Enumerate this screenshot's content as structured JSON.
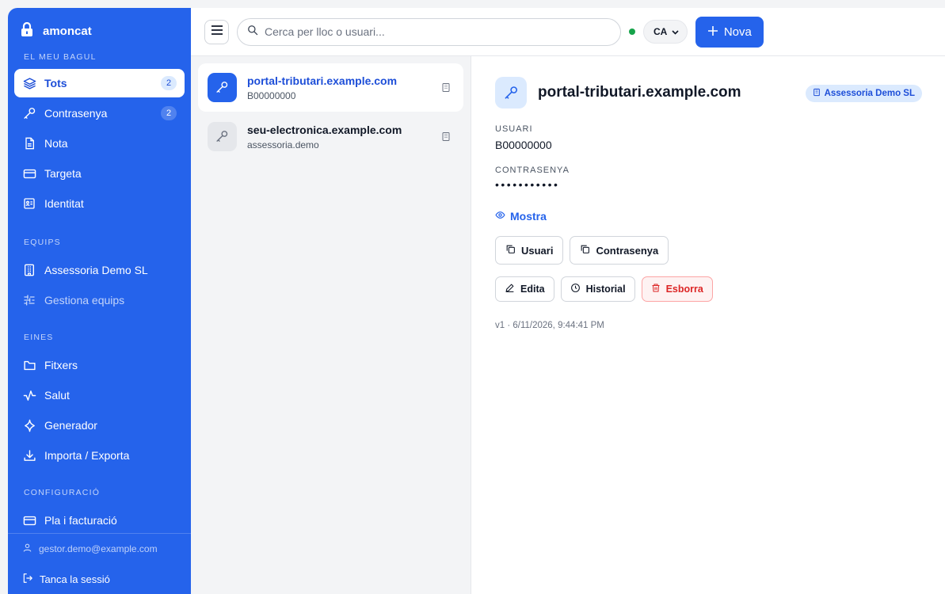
{
  "brand": {
    "name": "amoncat",
    "icon": "lock-icon"
  },
  "sidebar": {
    "sections": {
      "vault": "EL MEU BAGUL",
      "teams": "EQUIPS",
      "tools": "EINES",
      "settings": "CONFIGURACIÓ"
    },
    "vault_items": [
      {
        "label": "Tots",
        "count": "2",
        "icon": "layers-icon",
        "active": true
      },
      {
        "label": "Contrasenya",
        "count": "2",
        "icon": "key-icon"
      },
      {
        "label": "Nota",
        "icon": "note-icon"
      },
      {
        "label": "Targeta",
        "icon": "card-icon"
      },
      {
        "label": "Identitat",
        "icon": "id-card-icon"
      }
    ],
    "team_items": [
      {
        "label": "Assessoria Demo SL",
        "icon": "building-icon"
      },
      {
        "label": "Gestiona equips",
        "icon": "sliders-icon"
      }
    ],
    "tool_items": [
      {
        "label": "Fitxers",
        "icon": "folder-icon"
      },
      {
        "label": "Salut",
        "icon": "pulse-icon"
      },
      {
        "label": "Generador",
        "icon": "sparkle-icon"
      },
      {
        "label": "Importa / Exporta",
        "icon": "download-icon"
      }
    ],
    "settings_items": [
      {
        "label": "Pla i facturació",
        "icon": "card-icon"
      }
    ],
    "footer": {
      "email": "gestor.demo@example.com",
      "logout": "Tanca la sessió"
    }
  },
  "topbar": {
    "search_placeholder": "Cerca per lloc o usuari...",
    "language": "CA",
    "new_button": "Nova",
    "status_color": "#16a34a"
  },
  "list": {
    "items": [
      {
        "title": "portal-tributari.example.com",
        "subtitle": "B00000000",
        "selected": true
      },
      {
        "title": "seu-electronica.example.com",
        "subtitle": "assessoria.demo",
        "selected": false
      }
    ]
  },
  "detail": {
    "title": "portal-tributari.example.com",
    "team_badge": "Assessoria Demo SL",
    "user_label": "USUARI",
    "user_value": "B00000000",
    "password_label": "CONTRASENYA",
    "password_mask": "•••••••••••",
    "show_label": "Mostra",
    "copy_user": "Usuari",
    "copy_password": "Contrasenya",
    "edit": "Edita",
    "history": "Historial",
    "delete": "Esborra",
    "meta": "v1 · 6/11/2026, 9:44:41 PM"
  },
  "colors": {
    "accent": "#2563eb",
    "danger": "#dc2626"
  }
}
